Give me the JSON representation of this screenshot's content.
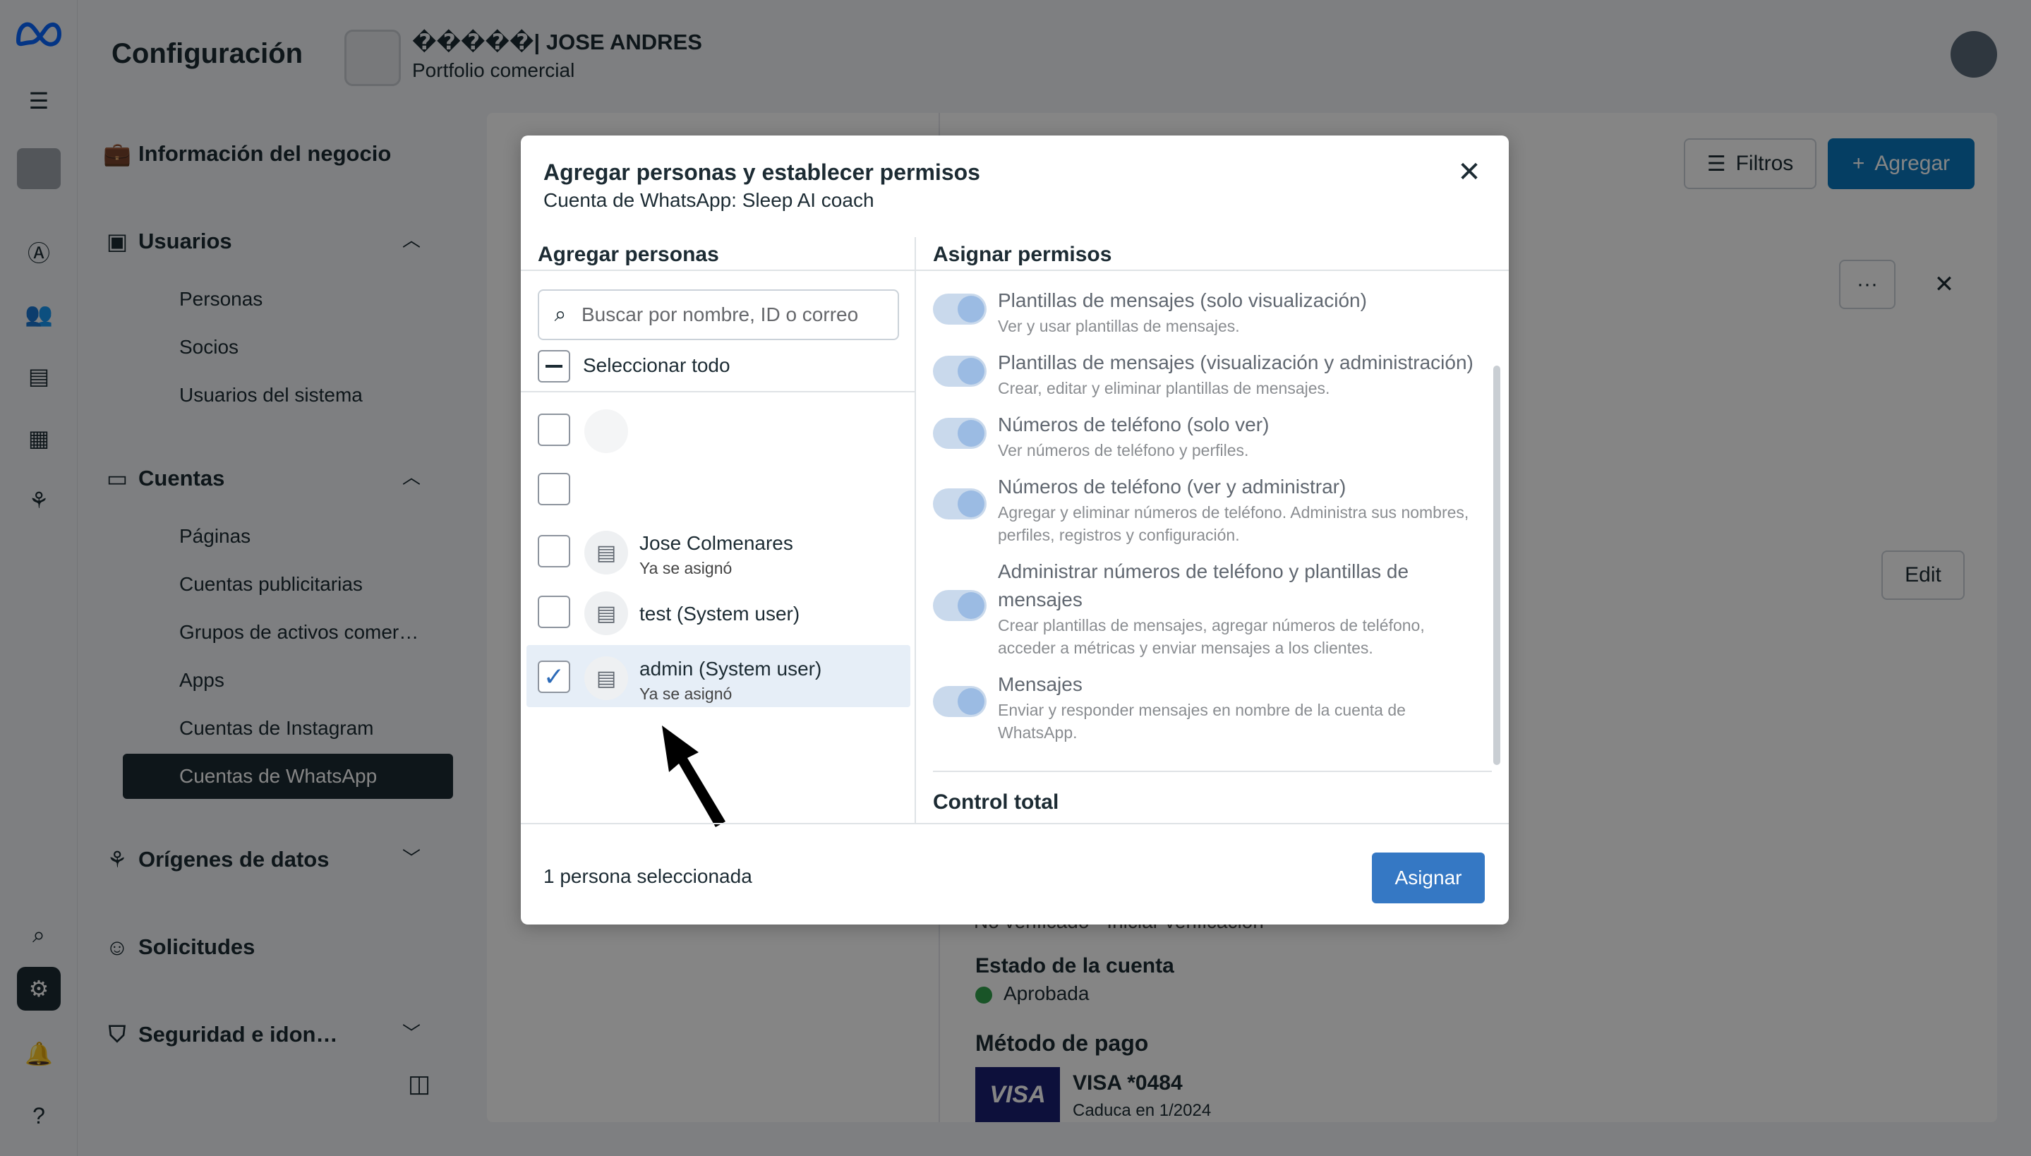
{
  "header": {
    "title": "Configuración",
    "business_name": "�����| JOSE ANDRES",
    "business_sub": "Portfolio comercial"
  },
  "sidebar": {
    "business_info": "Información del negocio",
    "users": {
      "label": "Usuarios",
      "items": [
        "Personas",
        "Socios",
        "Usuarios del sistema"
      ]
    },
    "accounts": {
      "label": "Cuentas",
      "items": [
        "Páginas",
        "Cuentas publicitarias",
        "Grupos de activos comer…",
        "Apps",
        "Cuentas de Instagram",
        "Cuentas de WhatsApp"
      ]
    },
    "data_sources": "Orígenes de datos",
    "requests": "Solicitudes",
    "security": "Seguridad e idon…"
  },
  "background": {
    "filters_label": "Filtros",
    "add_label": "Agregar",
    "more_label": "···",
    "edit_label": "Edit",
    "verify_text": "No verificado · Iniciar verificación",
    "account_status_label": "Estado de la cuenta",
    "account_status_value": "Aprobada",
    "payment_label": "Método de pago",
    "card_brand": "VISA",
    "card_name": "VISA *0484",
    "card_expiry": "Caduca en 1/2024"
  },
  "modal": {
    "title": "Agregar personas y establecer permisos",
    "subtitle": "Cuenta de WhatsApp: Sleep AI coach",
    "left_heading": "Agregar personas",
    "search_placeholder": "Buscar por nombre, ID o correo",
    "select_all": "Seleccionar todo",
    "people": [
      {
        "name": "",
        "note": "",
        "checked": false
      },
      {
        "name": "",
        "note": "",
        "checked": false
      },
      {
        "name": "Jose Colmenares",
        "note": "Ya se asignó",
        "checked": false
      },
      {
        "name": "test (System user)",
        "note": "",
        "checked": false
      },
      {
        "name": "admin (System user)",
        "note": "Ya se asignó",
        "checked": true
      }
    ],
    "right_heading": "Asignar permisos",
    "permissions": [
      {
        "title": "Plantillas de mensajes (solo visualización)",
        "desc": "Ver y usar plantillas de mensajes."
      },
      {
        "title": "Plantillas de mensajes (visualización y administración)",
        "desc": "Crear, editar y eliminar plantillas de mensajes."
      },
      {
        "title": "Números de teléfono (solo ver)",
        "desc": "Ver números de teléfono y perfiles."
      },
      {
        "title": "Números de teléfono (ver y administrar)",
        "desc": "Agregar y eliminar números de teléfono. Administra sus nombres, perfiles, registros y configuración."
      },
      {
        "title": "Administrar números de teléfono y plantillas de mensajes",
        "desc": "Crear plantillas de mensajes, agregar números de teléfono, acceder a métricas y enviar mensajes a los clientes."
      },
      {
        "title": "Mensajes",
        "desc": "Enviar y responder mensajes en nombre de la cuenta de WhatsApp."
      }
    ],
    "full_control": "Control total",
    "selected_count": "1 persona seleccionada",
    "assign_label": "Asignar"
  },
  "colors": {
    "accent": "#3578c4",
    "dark": "#1c2b33",
    "approved": "#31a24c"
  }
}
